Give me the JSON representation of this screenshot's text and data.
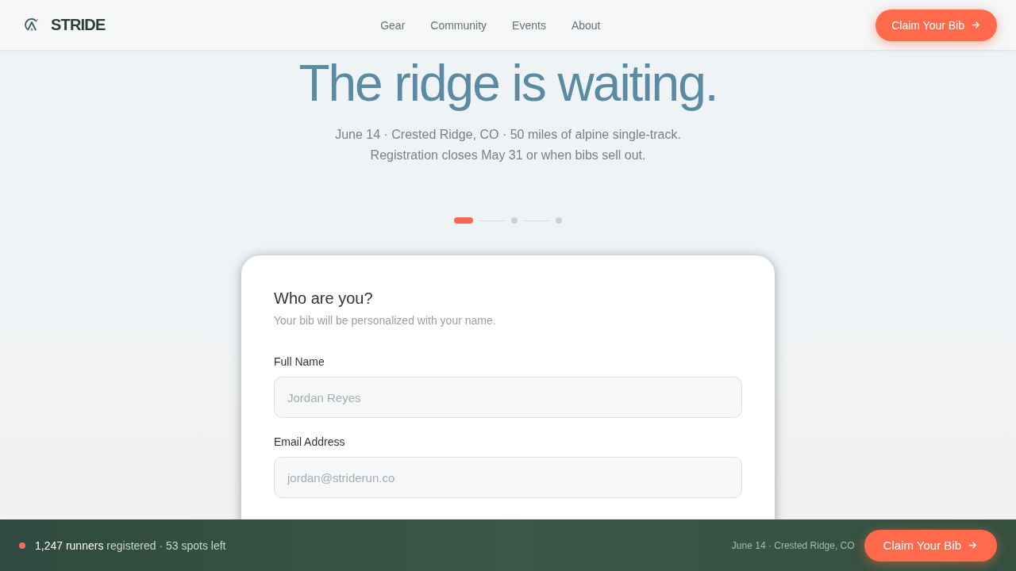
{
  "header": {
    "brand": "STRIDE",
    "nav": [
      "Gear",
      "Community",
      "Events",
      "About"
    ],
    "cta": "Claim Your Bib"
  },
  "hero": {
    "title": "The ridge is waiting.",
    "subtitle": "June 14 · Crested Ridge, CO · 50 miles of alpine single-track. Registration closes May 31 or when bibs sell out."
  },
  "steps": [
    {
      "active": true
    },
    {
      "active": false
    },
    {
      "active": false
    }
  ],
  "form": {
    "heading": "Who are you?",
    "subheading": "Your bib will be personalized with your name.",
    "fields": [
      {
        "label": "Full Name",
        "placeholder": "Jordan Reyes"
      },
      {
        "label": "Email Address",
        "placeholder": "jordan@striderun.co"
      }
    ]
  },
  "bottom_bar": {
    "status": "**1,247 runners** registered · 53 spots left",
    "event_info": "June 14 · Crested Ridge, CO",
    "cta": "Claim Your Bib"
  }
}
